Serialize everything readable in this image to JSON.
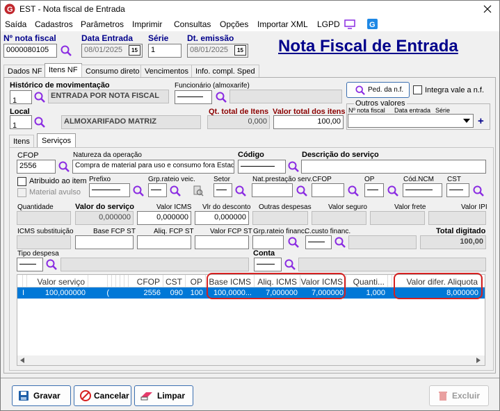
{
  "window": {
    "title": "EST - Nota fiscal de Entrada"
  },
  "menu": [
    "Saída",
    "Cadastros",
    "Parâmetros",
    "Imprimir",
    "Consultas",
    "Opções",
    "Importar XML",
    "LGPD"
  ],
  "header": {
    "nota_label": "Nº nota fiscal",
    "nota_value": "0000080105",
    "data_entrada_label": "Data Entrada",
    "data_entrada_value": "08/01/2025",
    "serie_label": "Série",
    "serie_value": "1",
    "dt_emissao_label": "Dt. emissão",
    "dt_emissao_value": "08/01/2025",
    "big_title": "Nota Fiscal de Entrada",
    "cal_icon_text": "15"
  },
  "tabs": [
    "Dados NF",
    "Itens NF",
    "Consumo direto",
    "Vencimentos",
    "Info. compl. Sped"
  ],
  "itens_nf": {
    "historico_label": "Histórico de movimentação",
    "historico_code": "1",
    "historico_desc": "ENTRADA POR NOTA FISCAL",
    "funcionario_label": "Funcionário (almoxarife)",
    "ped_button": "Ped. da n.f.",
    "integra_label": "Integra vale a n.f.",
    "local_label": "Local",
    "local_code": "1",
    "local_desc": "ALMOXARIFADO MATRIZ",
    "qt_total_label": "Qt. total de Itens",
    "qt_total_value": "0,000",
    "valor_total_label": "Valor total dos itens",
    "valor_total_value": "100,00",
    "outros_valores_label": "Outros valores",
    "nota_fiscal_col": "Nº nota fiscal",
    "data_entrada_col": "Data entrada",
    "serie_col": "Série",
    "add_icon": "+"
  },
  "subtabs": [
    "Itens",
    "Serviços"
  ],
  "servicos": {
    "cfop_label": "CFOP",
    "cfop_value": "2556",
    "natureza_label": "Natureza da operação",
    "natureza_value": "Compra de material para uso e consumo fora Estado",
    "codigo_label": "Código",
    "descricao_label": "Descrição do serviço",
    "atribuido_label": "Atribuido ao item",
    "material_avulso_label": "Material avulso",
    "prefixo_label": "Prefixo",
    "grp_rateio_veic_label": "Grp.rateio veic.",
    "setor_label": "Setor",
    "nat_prest_label": "Nat.prestação serv.",
    "cfop2_label": "CFOP",
    "op_label": "OP",
    "cod_ncm_label": "Cód.NCM",
    "cst_label": "CST",
    "quantidade_label": "Quantidade",
    "valor_servico_label": "Valor do serviço",
    "valor_servico_value": "0,000000",
    "valor_icms_label": "Valor ICMS",
    "valor_icms_value": "0,000000",
    "vlr_desconto_label": "Vlr do desconto",
    "vlr_desconto_value": "0,000000",
    "outras_despesas_label": "Outras despesas",
    "valor_seguro_label": "Valor seguro",
    "valor_frete_label": "Valor frete",
    "valor_ipi_label": "Valor IPI",
    "icms_subst_label": "ICMS substituição",
    "base_fcp_label": "Base FCP ST",
    "aliq_fcp_label": "Aliq. FCP ST",
    "valor_fcp_label": "Valor FCP ST",
    "grp_rateio_fin_label": "Grp.rateio financ.",
    "c_custo_label": "C.custo financ.",
    "total_digitado_label": "Total digitado",
    "total_digitado_value": "100,00",
    "tipo_despesa_label": "Tipo despesa",
    "conta_label": "Conta"
  },
  "grid": {
    "columns": [
      "Valor serviço",
      "CFOP",
      "CST",
      "OP",
      "Base ICMS",
      "Aliq. ICMS",
      "Valor ICMS",
      "Quanti...",
      "Valor difer. Aliquota"
    ],
    "row": {
      "marker": "I",
      "valor_servico": "100,000000",
      "extra": "(",
      "cfop": "2556",
      "cst": "090",
      "op": "100",
      "base_icms": "100,0000...",
      "aliq_icms": "7,000000",
      "valor_icms": "7,000000",
      "quantidade": "1,000",
      "valor_difer": "8,000000"
    }
  },
  "buttons": {
    "gravar": "Gravar",
    "cancelar": "Cancelar",
    "limpar": "Limpar",
    "excluir": "Excluir"
  },
  "colors": {
    "accent": "#00008b",
    "selection": "#0078d7",
    "highlight": "#d62020",
    "icon_purple": "#8a2be2"
  }
}
